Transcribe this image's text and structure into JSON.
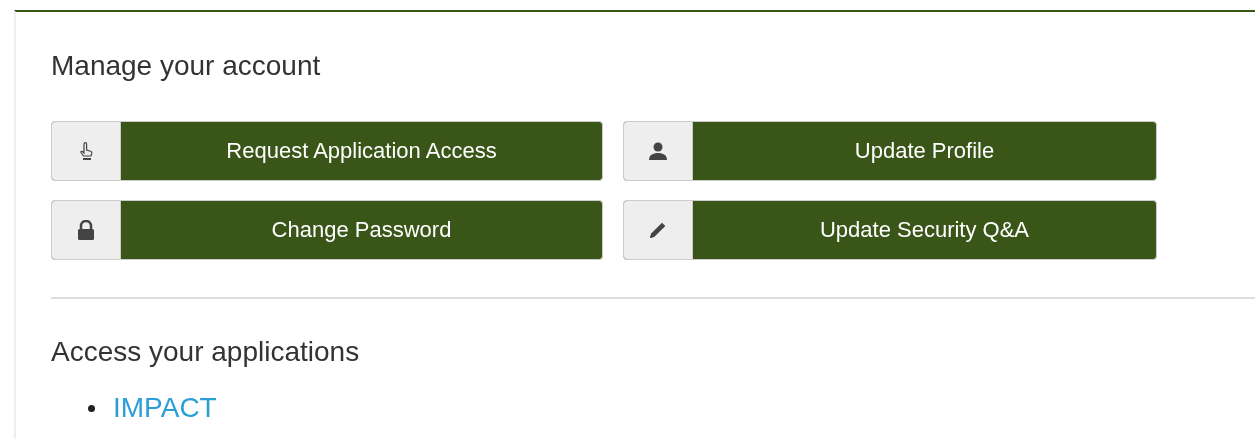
{
  "account": {
    "heading": "Manage your account",
    "buttons": [
      {
        "label": "Request Application Access",
        "kind": "hand"
      },
      {
        "label": "Update Profile",
        "kind": "user"
      },
      {
        "label": "Change Password",
        "kind": "lock"
      },
      {
        "label": "Update Security Q&A",
        "kind": "pencil"
      }
    ]
  },
  "applications": {
    "heading": "Access your applications",
    "links": [
      "IMPACT"
    ]
  }
}
